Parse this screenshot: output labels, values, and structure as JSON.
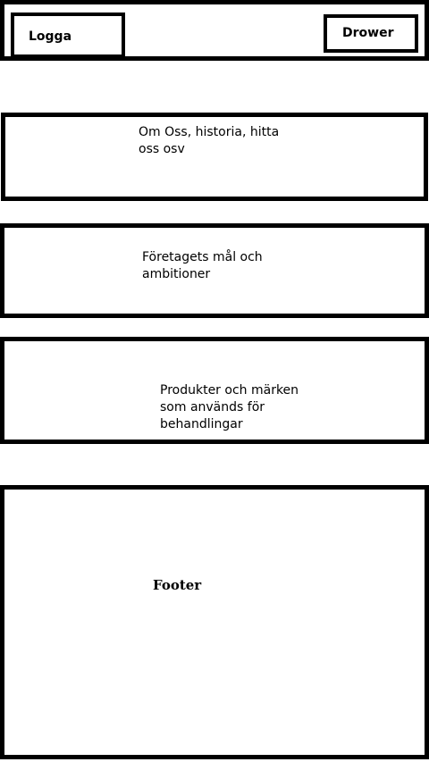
{
  "header": {
    "logo_label": "Logga",
    "drawer_label": "Drower"
  },
  "sections": [
    {
      "text": "Om Oss, historia, hitta oss osv"
    },
    {
      "text": "Företagets mål och ambitioner"
    },
    {
      "text": "Produkter och märken som används för behandlingar"
    }
  ],
  "footer": {
    "label": "Footer"
  }
}
